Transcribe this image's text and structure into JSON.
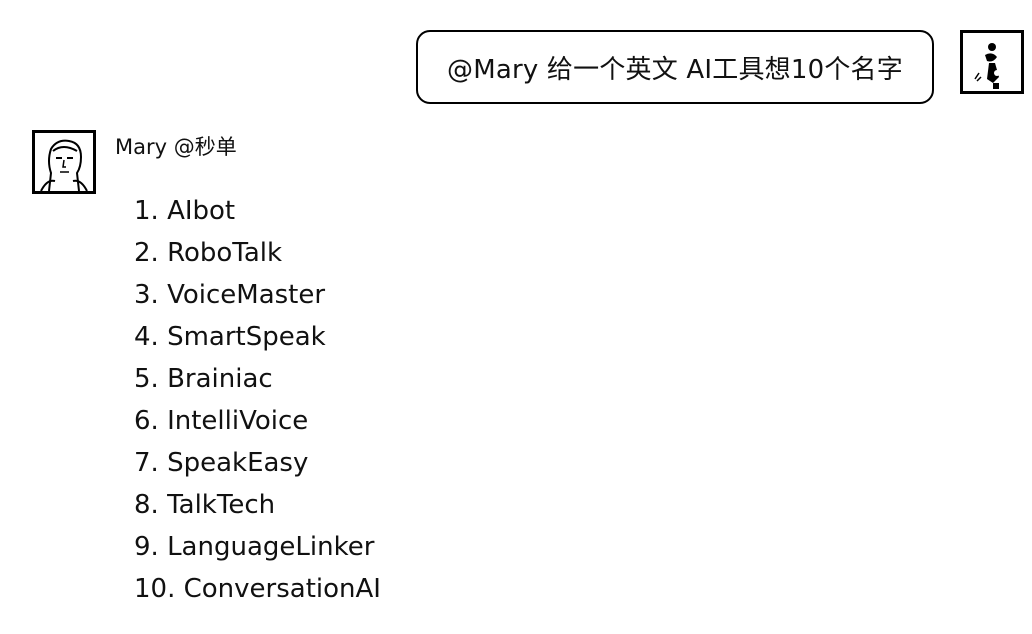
{
  "outgoing_message": {
    "text": "@Mary 给一个英文 AI工具想10个名字",
    "avatar_icon": "user-avatar-icon"
  },
  "incoming_message": {
    "sender": "Mary @秒单",
    "avatar_icon": "mary-avatar-icon",
    "items": [
      "1. AIbot",
      "2. RoboTalk",
      "3. VoiceMaster",
      "4. SmartSpeak",
      "5. Brainiac",
      "6. IntelliVoice",
      "7. SpeakEasy",
      "8. TalkTech",
      "9. LanguageLinker",
      "10. ConversationAI"
    ]
  },
  "colors": {
    "background": "#ffffff",
    "text": "#111111",
    "border": "#000000"
  }
}
